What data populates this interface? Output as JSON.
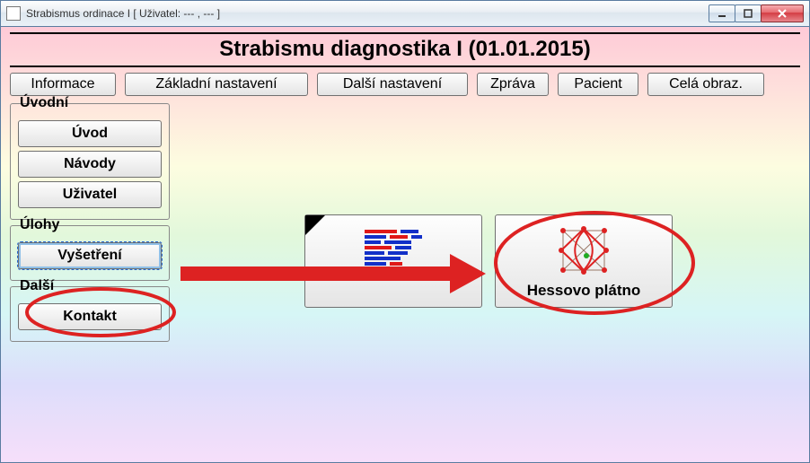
{
  "window": {
    "title": "Strabismus ordinace I [ Uživatel: --- , --- ]"
  },
  "header": {
    "title": "Strabismu diagnostika I (01.01.2015)"
  },
  "toolbar": {
    "informace": "Informace",
    "zakladni": "Základní nastavení",
    "dalsi": "Další nastavení",
    "zprava": "Zpráva",
    "pacient": "Pacient",
    "celaobr": "Celá obraz."
  },
  "sidebar": {
    "groups": {
      "uvodni": {
        "legend": "Úvodní",
        "items": [
          {
            "label": "Úvod"
          },
          {
            "label": "Návody"
          },
          {
            "label": "Uživatel"
          }
        ]
      },
      "ulohy": {
        "legend": "Úlohy",
        "items": [
          {
            "label": "Vyšetření"
          }
        ]
      },
      "dalsi": {
        "legend": "Další",
        "items": [
          {
            "label": "Kontakt"
          }
        ]
      }
    }
  },
  "cards": {
    "card2": {
      "label": "Hessovo plátno"
    }
  }
}
